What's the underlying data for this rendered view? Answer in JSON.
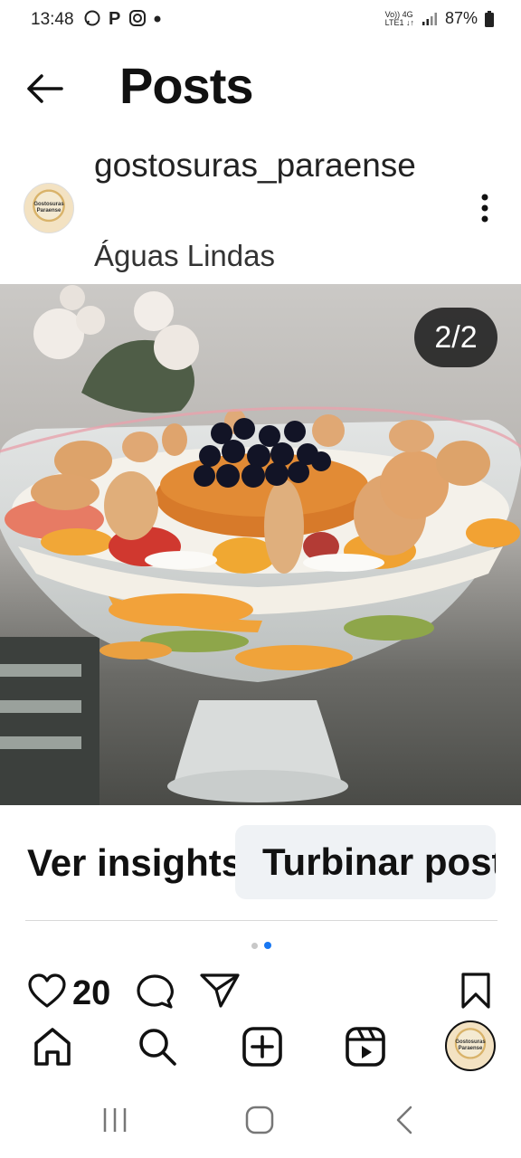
{
  "status_bar": {
    "time": "13:48",
    "signal_top": "Vo)) 4G",
    "signal_bottom": "LTE1 ↓↑",
    "battery": "87%"
  },
  "header": {
    "title": "Posts",
    "back_icon": "arrow-left-icon"
  },
  "post": {
    "username": "gostosuras_paraense",
    "location": "Águas Lindas",
    "avatar_text": "Gostosuras Paraense",
    "counter": "2/2",
    "like_count": "20"
  },
  "actions": {
    "insights_label": "Ver insights",
    "boost_label": "Turbinar post"
  },
  "carousel": {
    "total": 2,
    "active_index": 2,
    "active_color": "#1877f2",
    "inactive_color": "#c8c8c8"
  },
  "icons": [
    "heart-icon",
    "comment-icon",
    "share-icon",
    "bookmark-icon",
    "home-icon",
    "search-icon",
    "create-icon",
    "reels-icon",
    "profile-avatar"
  ]
}
